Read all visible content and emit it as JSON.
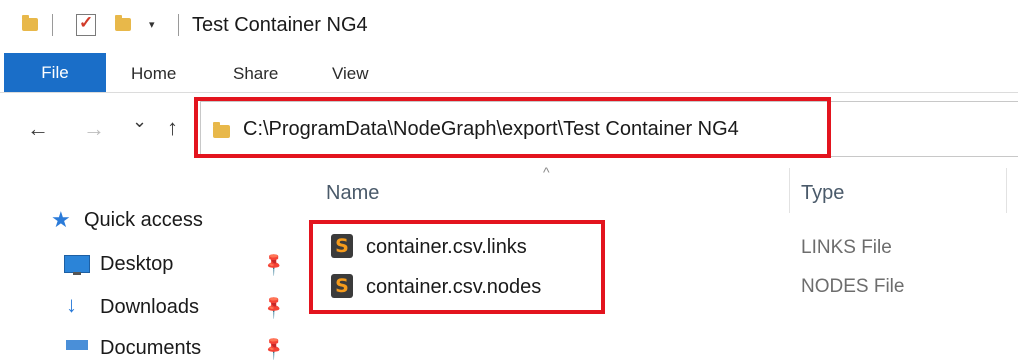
{
  "window": {
    "title": "Test Container NG4",
    "quick_access_toolbar": {
      "icons": [
        "folder-icon",
        "properties-icon",
        "new-folder-icon",
        "customize-dropdown-icon"
      ],
      "dropdown_glyph": "▾"
    }
  },
  "ribbon": {
    "tabs": [
      {
        "label": "File",
        "active": true
      },
      {
        "label": "Home"
      },
      {
        "label": "Share"
      },
      {
        "label": "View"
      }
    ],
    "accent_color": "#1a6ec8"
  },
  "navigation": {
    "back_glyph": "←",
    "forward_glyph": "→",
    "recent_glyph": "⌄",
    "up_glyph": "↑",
    "address": "C:\\ProgramData\\NodeGraph\\export\\Test Container NG4"
  },
  "nav_pane": {
    "quick_access_label": "Quick access",
    "items": [
      {
        "label": "Desktop",
        "icon": "desktop-icon",
        "pinned": true
      },
      {
        "label": "Downloads",
        "icon": "download-arrow-icon",
        "pinned": true
      },
      {
        "label": "Documents",
        "icon": "documents-icon",
        "pinned": true
      }
    ]
  },
  "file_list": {
    "columns": {
      "name": "Name",
      "type": "Type"
    },
    "sort_glyph": "^",
    "files": [
      {
        "name": "container.csv.links",
        "type": "LINKS File",
        "icon": "sublime-text-icon"
      },
      {
        "name": "container.csv.nodes",
        "type": "NODES File",
        "icon": "sublime-text-icon"
      }
    ]
  },
  "file_icon_glyph": "S",
  "highlight_color": "#e3141e"
}
